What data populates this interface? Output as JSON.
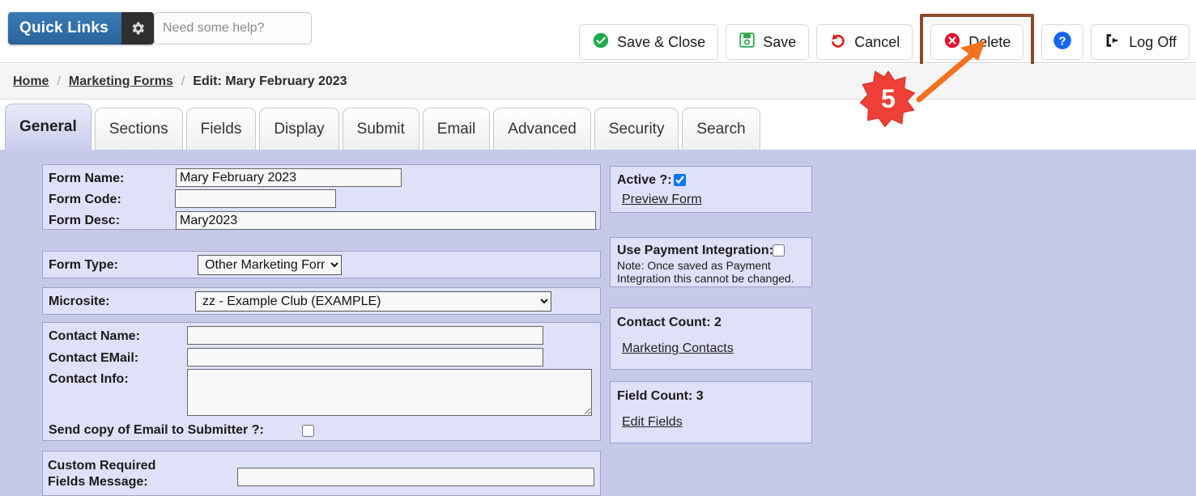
{
  "topbar": {
    "quick_links_label": "Quick Links",
    "gear_icon": "gear-icon",
    "search_placeholder": "Need some help?",
    "search_value": "",
    "buttons": [
      {
        "label": "Save & Close",
        "icon": "check-circle-icon"
      },
      {
        "label": "Save",
        "icon": "floppy-disk-icon"
      },
      {
        "label": "Cancel",
        "icon": "undo-arrow-icon"
      },
      {
        "label": "Delete",
        "icon": "x-circle-icon"
      },
      {
        "label": "",
        "icon": "help-question-icon"
      },
      {
        "label": "Log Off",
        "icon": "logout-icon"
      }
    ]
  },
  "breadcrumb": {
    "home": "Home",
    "marketing_forms": "Marketing Forms",
    "separator": "/",
    "current": "Edit: Mary February 2023"
  },
  "tabs": [
    {
      "label": "General",
      "active": true
    },
    {
      "label": "Sections",
      "active": false
    },
    {
      "label": "Fields",
      "active": false
    },
    {
      "label": "Display",
      "active": false
    },
    {
      "label": "Submit",
      "active": false
    },
    {
      "label": "Email",
      "active": false
    },
    {
      "label": "Advanced",
      "active": false
    },
    {
      "label": "Security",
      "active": false
    },
    {
      "label": "Search",
      "active": false
    }
  ],
  "form": {
    "form_name_label": "Form Name:",
    "form_name_value": "Mary February 2023",
    "form_code_label": "Form Code:",
    "form_code_value": "",
    "form_desc_label": "Form Desc:",
    "form_desc_value": "Mary2023",
    "form_type_label": "Form Type:",
    "form_type_value": "Other Marketing Form",
    "microsite_label": "Microsite:",
    "microsite_value": "zz - Example Club (EXAMPLE)",
    "contact_name_label": "Contact Name:",
    "contact_name_value": "",
    "contact_email_label": "Contact EMail:",
    "contact_email_value": "",
    "contact_info_label": "Contact Info:",
    "contact_info_value": "",
    "send_copy_label": "Send copy of Email to Submitter ?:",
    "send_copy_checked": false,
    "custom_required_label": "Custom Required Fields Message:",
    "custom_required_value": ""
  },
  "sidepanels": {
    "active_label": "Active ?:",
    "active_checked": true,
    "preview_form_link": "Preview Form",
    "payment_label": "Use Payment Integration:",
    "payment_checked": false,
    "payment_note": "Note: Once saved as Payment Integration this cannot be changed.",
    "contact_count_title": "Contact Count: 2",
    "marketing_contacts_link": "Marketing Contacts",
    "field_count_title": "Field Count: 3",
    "edit_fields_link": "Edit Fields"
  },
  "annotation": {
    "step_number": "5",
    "badge_color": "#ee4036",
    "arrow_color": "#f4711f",
    "highlight_color": "#8a4a2c",
    "target": "Delete"
  }
}
